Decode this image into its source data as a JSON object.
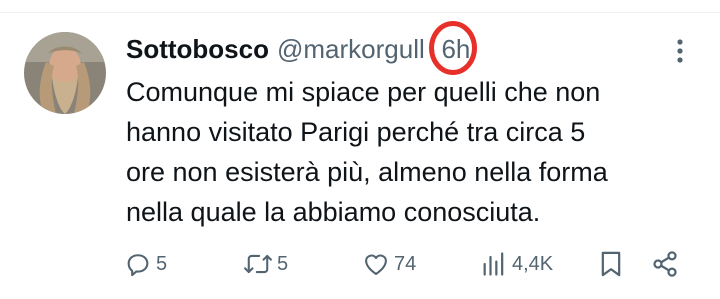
{
  "tweet": {
    "display_name": "Sottobosco",
    "handle": "@markorgull",
    "separator": "·",
    "time": "6h",
    "text": "Comunque mi spiace per quelli che non\nhanno visitato Parigi perché tra circa 5\nore non esisterà più, almeno nella forma\nnella quale la abbiamo conosciuta.",
    "annotation_color": "#e8302a"
  },
  "actions": {
    "reply_count": "5",
    "retweet_count": "5",
    "like_count": "74",
    "view_count": "4,4K",
    "icons": [
      "reply-icon",
      "retweet-icon",
      "like-icon",
      "views-icon",
      "bookmark-icon",
      "share-icon"
    ]
  },
  "colors": {
    "text": "#0f1419",
    "secondary": "#536471"
  }
}
